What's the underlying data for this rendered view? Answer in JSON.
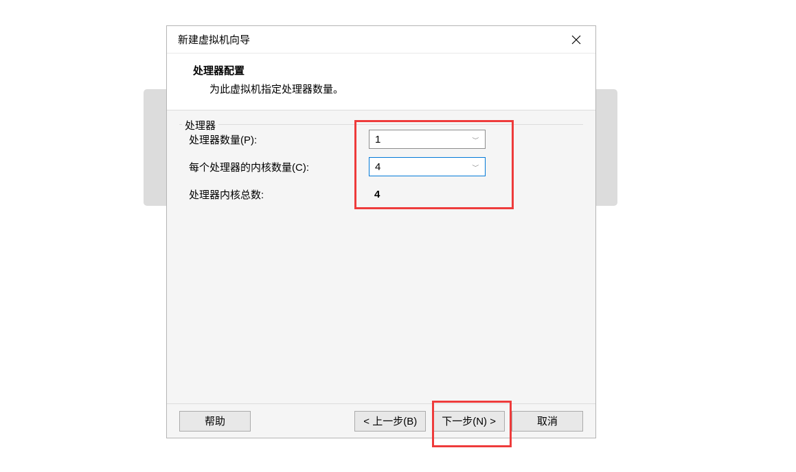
{
  "dialog": {
    "title": "新建虚拟机向导",
    "header": {
      "title": "处理器配置",
      "subtitle": "为此虚拟机指定处理器数量。"
    },
    "fieldset": {
      "legend": "处理器",
      "rows": {
        "processor_count": {
          "label": "处理器数量(P):",
          "value": "1"
        },
        "cores_per_processor": {
          "label": "每个处理器的内核数量(C):",
          "value": "4"
        },
        "total_cores": {
          "label": "处理器内核总数:",
          "value": "4"
        }
      }
    },
    "footer": {
      "help": "帮助",
      "back": "< 上一步(B)",
      "next": "下一步(N) >",
      "cancel": "取消"
    }
  }
}
